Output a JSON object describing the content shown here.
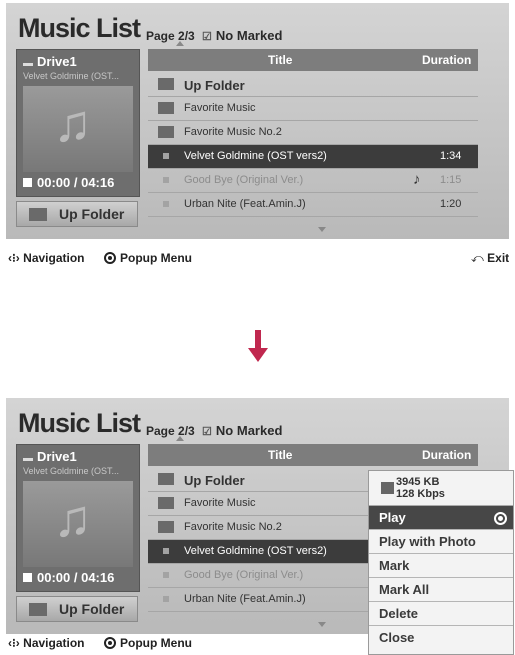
{
  "screen": {
    "title": "Music List",
    "page_label": "Page 2/3",
    "marked_label": "No Marked",
    "drive": "Drive1",
    "album": "Velvet Goldmine (OST...",
    "time": "00:00 / 04:16",
    "up_folder_button": "Up Folder",
    "columns": {
      "title": "Title",
      "duration": "Duration"
    },
    "rows": [
      {
        "title": "Up Folder",
        "duration": ""
      },
      {
        "title": "Favorite Music",
        "duration": ""
      },
      {
        "title": "Favorite Music No.2",
        "duration": ""
      },
      {
        "title": "Velvet Goldmine (OST vers2)",
        "duration": "1:34"
      },
      {
        "title": "Good Bye (Original Ver.)",
        "duration": "1:15"
      },
      {
        "title": "Urban Nite (Feat.Amin.J)",
        "duration": "1:20"
      }
    ]
  },
  "hints": {
    "navigation": "Navigation",
    "popup_menu": "Popup Menu",
    "exit": "Exit"
  },
  "popup": {
    "size": "3945 KB",
    "bitrate": "128 Kbps",
    "items": [
      "Play",
      "Play with Photo",
      "Mark",
      "Mark All",
      "Delete",
      "Close"
    ]
  },
  "colors": {
    "arrow": "#c0284f",
    "selected_row": "#3c3c3c",
    "header": "#7d7d7d"
  }
}
